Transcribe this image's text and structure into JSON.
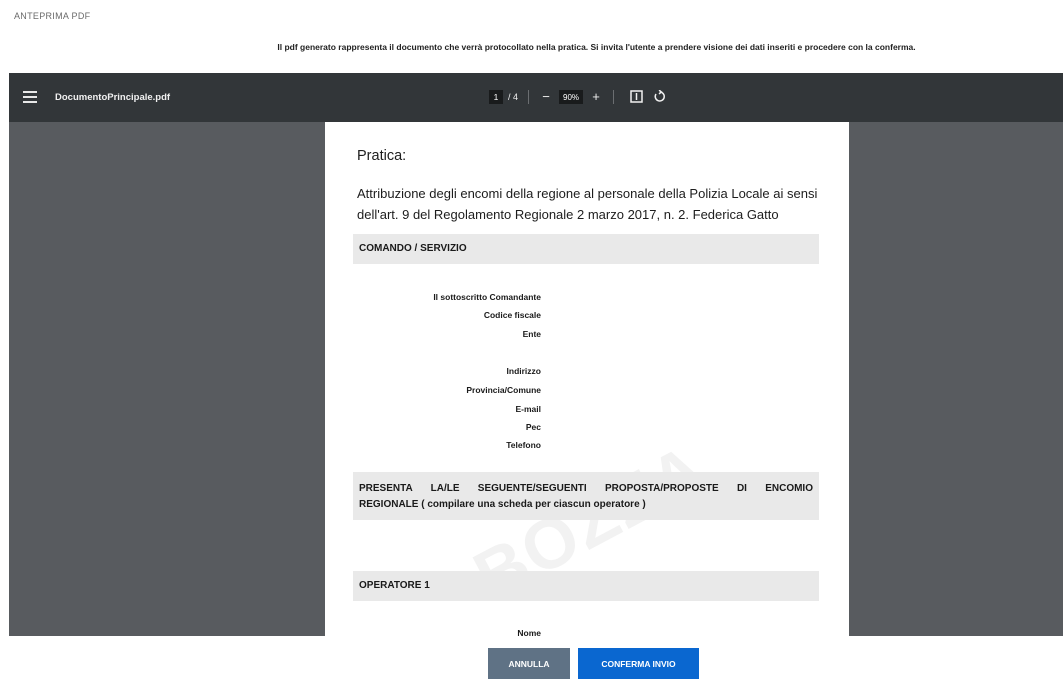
{
  "page": {
    "heading": "ANTEPRIMA PDF",
    "notice": "Il pdf generato rappresenta il documento che verrà protocollato nella pratica. Si invita l'utente a prendere visione dei dati inseriti e procedere con la conferma."
  },
  "viewer": {
    "file_name": "DocumentoPrincipale.pdf",
    "current_page": "1",
    "total_pages": "/ 4",
    "zoom": "90%",
    "icons": [
      "menu-icon",
      "minus-icon",
      "plus-icon",
      "fit-page-icon",
      "rotate-icon"
    ]
  },
  "document": {
    "pratica_label": "Pratica:",
    "title": "Attribuzione degli encomi della regione al personale della Polizia Locale ai sensi dell'art. 9 del Regolamento Regionale 2 marzo 2017, n. 2. Federica Gatto",
    "section_comando": "COMANDO / SERVIZIO",
    "fields_group1": [
      "Il sottoscritto Comandante",
      "Codice fiscale",
      "Ente"
    ],
    "fields_group2": [
      "Indirizzo",
      "Provincia/Comune",
      "E-mail",
      "Pec",
      "Telefono"
    ],
    "section_presenta_line1": "PRESENTA LA/LE SEGUENTE/SEGUENTI PROPOSTA/PROPOSTE DI ENCOMIO",
    "section_presenta_line2": "REGIONALE ( compilare una scheda per ciascun operatore )",
    "section_operatore": "OPERATORE 1",
    "field_nome": "Nome",
    "watermark": "BOZZA"
  },
  "actions": {
    "cancel_label": "ANNULLA",
    "confirm_label": "CONFERMA INVIO"
  },
  "colors": {
    "toolbar": "#323639",
    "viewer_bg": "#585b5f",
    "cancel_button": "#5f7285",
    "confirm_button": "#0a67d0"
  }
}
